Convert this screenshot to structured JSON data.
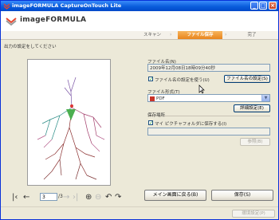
{
  "window": {
    "title": "imageFORMULA CaptureOnTouch Lite"
  },
  "header": {
    "brand": "imageFORMULA"
  },
  "steps": [
    {
      "label": "スキャン",
      "active": false
    },
    {
      "label": "ファイル保存",
      "active": true
    },
    {
      "label": "完了",
      "active": false
    }
  ],
  "instruction": "出力の設定をしてください",
  "pager": {
    "current_page": "3",
    "total": "/3"
  },
  "form": {
    "filename_label": "ファイル名(N)",
    "filename_value": "2009年12月08日18時09分40秒",
    "use_filename_setting_label": "ファイル名の設定を使う(U)",
    "use_filename_setting_checked": true,
    "filename_setting_button": "ファイル名の設定(S)",
    "filetype_label": "ファイル形式(T)",
    "filetype_value": "PDF",
    "detail_setting_button": "詳細設定(E)",
    "save_location_label": "保存場所",
    "save_to_mypictures_label": "マイ ピクチャフォルダに保存する(I)",
    "save_to_mypictures_checked": true,
    "browse_button": "参照(B)"
  },
  "buttons": {
    "back_to_menu": "メイン画面に戻る(B)",
    "save": "保存(S)",
    "status_task": "環境設定(P)"
  },
  "colors": {
    "accent": "#e9851c",
    "titlebar": "#0a5ddc"
  }
}
